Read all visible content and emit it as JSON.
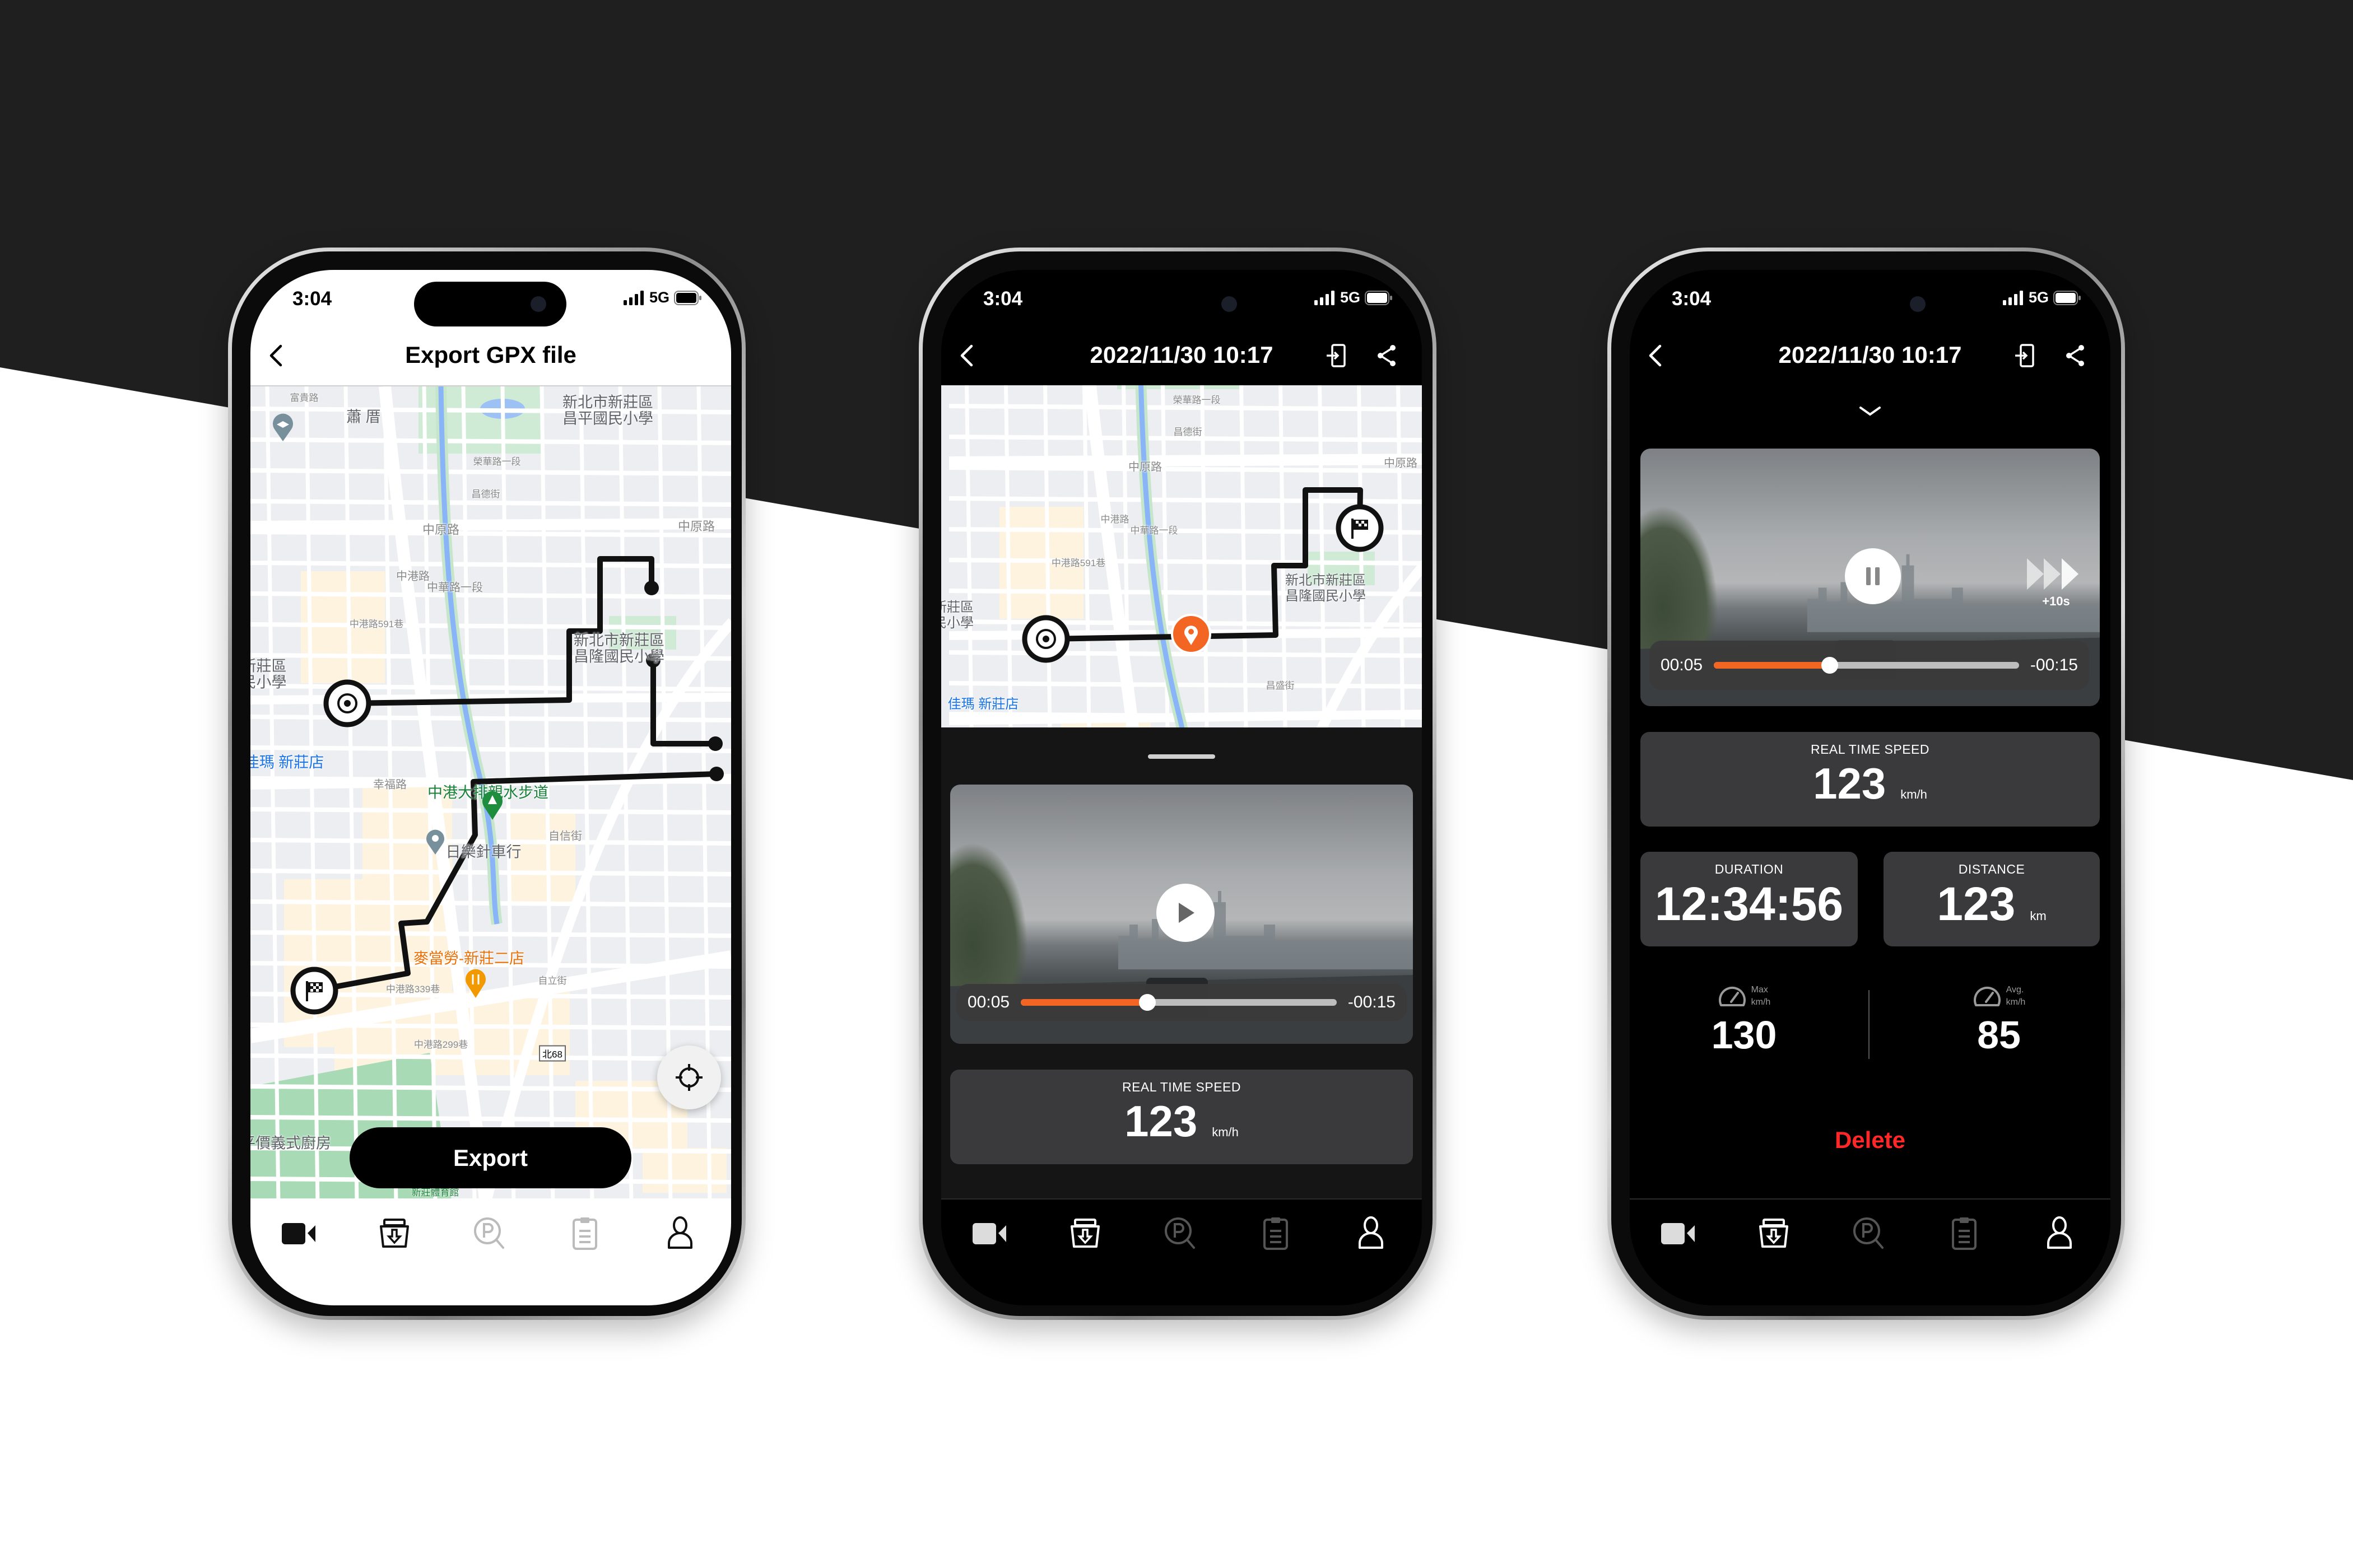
{
  "colors": {
    "accent": "#f26522",
    "danger": "#ff2727",
    "card": "#3a3a3c",
    "background_dark": "#1f1f1f"
  },
  "status_bar": {
    "time": "3:04",
    "network": "5G"
  },
  "tabbar": {
    "icons": [
      "video-camera-icon",
      "download-tray-icon",
      "parking-search-icon",
      "clipboard-icon",
      "person-icon"
    ],
    "active": 0
  },
  "phone1": {
    "title": "Export GPX file",
    "export_label": "Export",
    "map": {
      "labels": [
        "新北市新莊區",
        "昌平國民小學",
        "蕭 厝",
        "富貴路",
        "中原路",
        "中原路",
        "新北市新莊區",
        "昌隆國民小學",
        "佳瑪 新莊店",
        "新莊區",
        "民小學",
        "幸福路",
        "中港大排親水步道",
        "日樂針車行",
        "自信街",
        "麥當勞-新莊二店",
        "平價義式廚房",
        "自立街",
        "榮華路一段",
        "昌德街",
        "中港路",
        "中華路一段",
        "中港路591巷",
        "中港路339巷",
        "中港路299巷",
        "新莊體育館"
      ],
      "road_badge": "北68"
    }
  },
  "phone2": {
    "title": "2022/11/30 10:17",
    "map": {
      "labels": [
        "榮華路一段",
        "昌德街",
        "中原路",
        "中原路",
        "新北市新莊區",
        "昌隆國民小學",
        "新莊區",
        "民小學",
        "佳瑪 新莊店",
        "中港路",
        "中華路一段",
        "中港路591巷",
        "昌盛街"
      ]
    },
    "player": {
      "elapsed": "00:05",
      "remaining": "-00:15",
      "progress": 0.4,
      "state": "paused"
    },
    "speed": {
      "label": "REAL TIME SPEED",
      "value": "123",
      "unit": "km/h"
    }
  },
  "phone3": {
    "title": "2022/11/30 10:17",
    "player": {
      "elapsed": "00:05",
      "remaining": "-00:15",
      "progress": 0.38,
      "state": "playing",
      "skip_label": "+10s"
    },
    "speed": {
      "label": "REAL TIME SPEED",
      "value": "123",
      "unit": "km/h"
    },
    "duration": {
      "label": "DURATION",
      "value": "12:34:56"
    },
    "distance": {
      "label": "DISTANCE",
      "value": "123",
      "unit": "km"
    },
    "max": {
      "label": "Max",
      "unit": "km/h",
      "value": "130"
    },
    "avg": {
      "label": "Avg.",
      "unit": "km/h",
      "value": "85"
    },
    "delete_label": "Delete"
  }
}
